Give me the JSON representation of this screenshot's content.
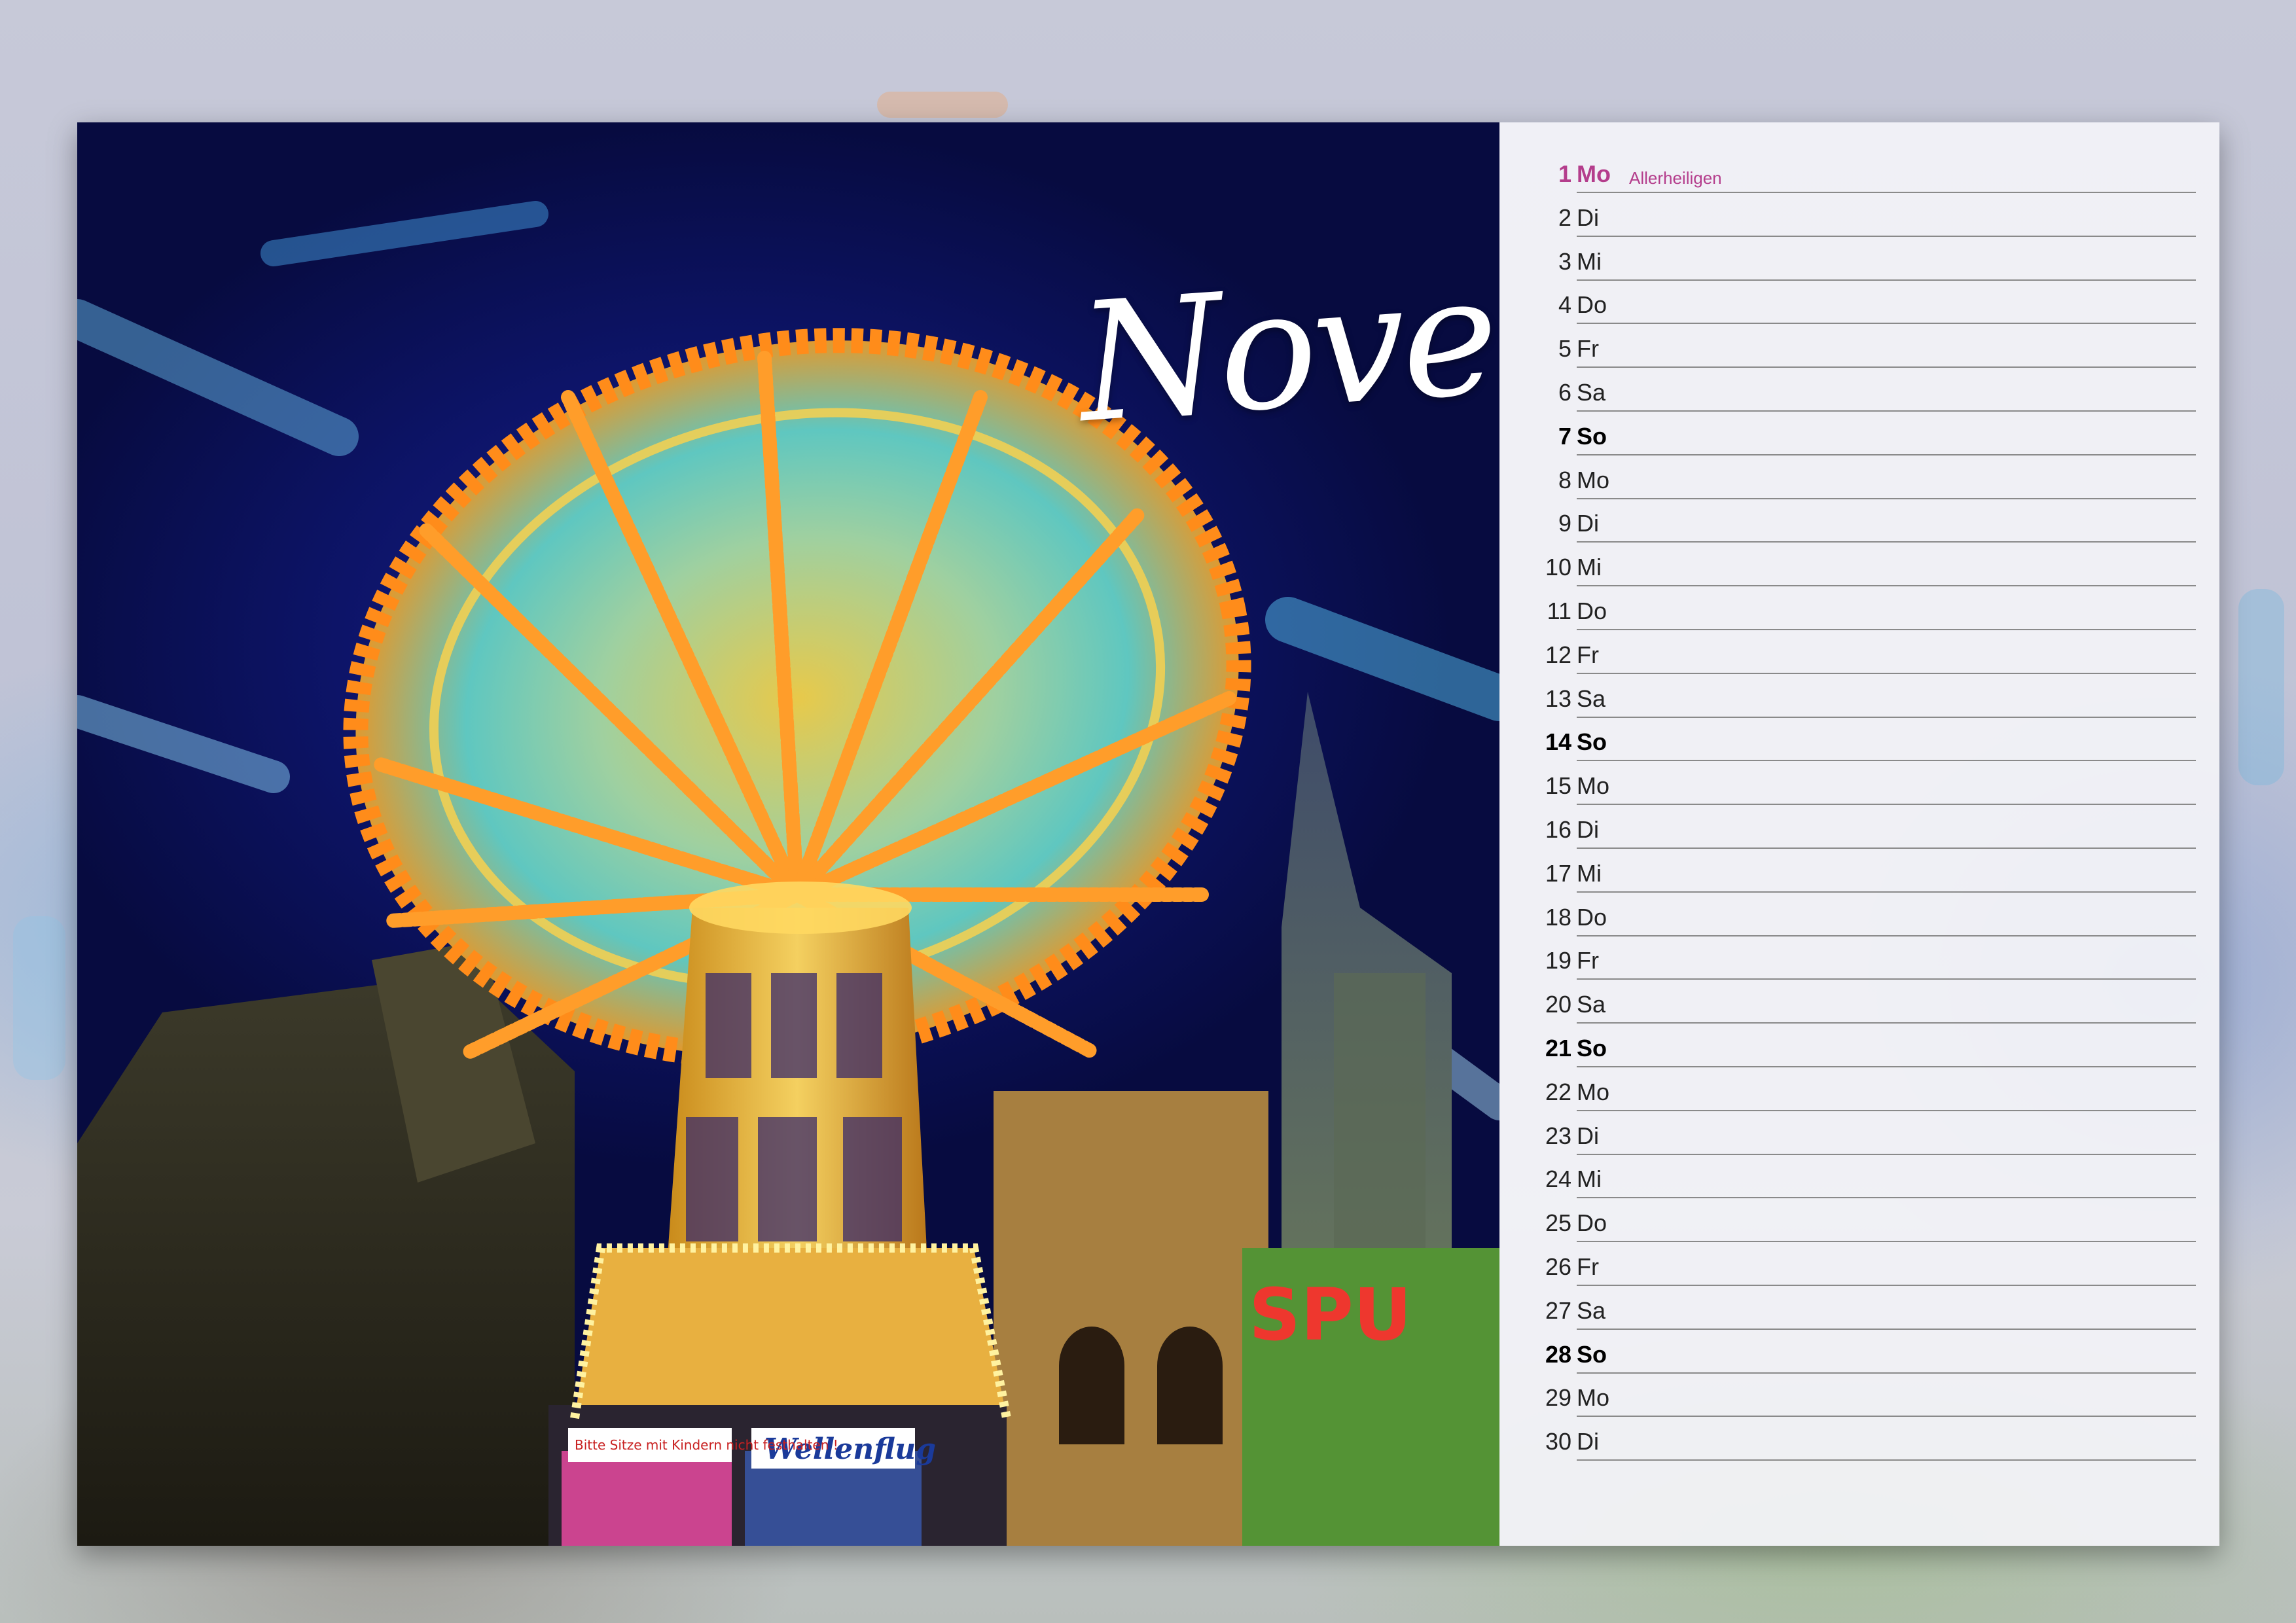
{
  "calendar": {
    "month": "November",
    "accent_color": "#b43d8c",
    "days": [
      {
        "num": "1",
        "weekday": "Mo",
        "holiday": "Allerheiligen",
        "type": "holiday"
      },
      {
        "num": "2",
        "weekday": "Di",
        "type": "normal"
      },
      {
        "num": "3",
        "weekday": "Mi",
        "type": "normal"
      },
      {
        "num": "4",
        "weekday": "Do",
        "type": "normal"
      },
      {
        "num": "5",
        "weekday": "Fr",
        "type": "normal"
      },
      {
        "num": "6",
        "weekday": "Sa",
        "type": "normal"
      },
      {
        "num": "7",
        "weekday": "So",
        "type": "sunday"
      },
      {
        "num": "8",
        "weekday": "Mo",
        "type": "normal"
      },
      {
        "num": "9",
        "weekday": "Di",
        "type": "normal"
      },
      {
        "num": "10",
        "weekday": "Mi",
        "type": "normal"
      },
      {
        "num": "11",
        "weekday": "Do",
        "type": "normal"
      },
      {
        "num": "12",
        "weekday": "Fr",
        "type": "normal"
      },
      {
        "num": "13",
        "weekday": "Sa",
        "type": "normal"
      },
      {
        "num": "14",
        "weekday": "So",
        "type": "sunday"
      },
      {
        "num": "15",
        "weekday": "Mo",
        "type": "normal"
      },
      {
        "num": "16",
        "weekday": "Di",
        "type": "normal"
      },
      {
        "num": "17",
        "weekday": "Mi",
        "type": "normal"
      },
      {
        "num": "18",
        "weekday": "Do",
        "type": "normal"
      },
      {
        "num": "19",
        "weekday": "Fr",
        "type": "normal"
      },
      {
        "num": "20",
        "weekday": "Sa",
        "type": "normal"
      },
      {
        "num": "21",
        "weekday": "So",
        "type": "sunday"
      },
      {
        "num": "22",
        "weekday": "Mo",
        "type": "normal"
      },
      {
        "num": "23",
        "weekday": "Di",
        "type": "normal"
      },
      {
        "num": "24",
        "weekday": "Mi",
        "type": "normal"
      },
      {
        "num": "25",
        "weekday": "Do",
        "type": "normal"
      },
      {
        "num": "26",
        "weekday": "Fr",
        "type": "normal"
      },
      {
        "num": "27",
        "weekday": "Sa",
        "type": "normal"
      },
      {
        "num": "28",
        "weekday": "So",
        "type": "sunday"
      },
      {
        "num": "29",
        "weekday": "Mo",
        "type": "normal"
      },
      {
        "num": "30",
        "weekday": "Di",
        "type": "normal"
      }
    ]
  },
  "photo": {
    "subject": "illuminated chain swing carousel at night fair",
    "signs": {
      "ride_name": "Wellenflug",
      "notice": "Bitte Sitze mit Kindern nicht festhalten !"
    }
  }
}
